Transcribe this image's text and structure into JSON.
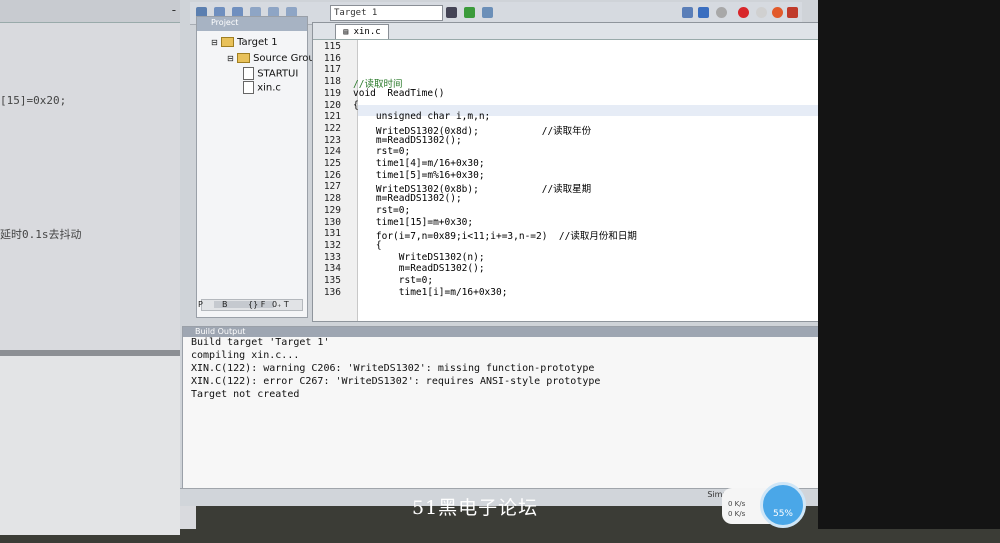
{
  "background_window": {
    "close_controls": "- ×",
    "code_fragment_1": "[15]=0x20;",
    "code_fragment_2": "延时0.1s去抖动"
  },
  "toolbar": {
    "target_select": "Target 1"
  },
  "project_panel": {
    "title": "Project",
    "tree": [
      {
        "label": "Target 1"
      },
      {
        "label": "Source Grou"
      },
      {
        "label": "STARTUI"
      },
      {
        "label": "xin.c"
      }
    ],
    "bottom_tabs": [
      "P",
      "B",
      "{} F",
      "0₊ T"
    ]
  },
  "editor": {
    "tab": "xin.c",
    "lines": [
      {
        "n": "115",
        "code": ""
      },
      {
        "n": "116",
        "code": ""
      },
      {
        "n": "117",
        "code": ""
      },
      {
        "n": "118",
        "code": "//读取时间"
      },
      {
        "n": "119",
        "code": "void  ReadTime()"
      },
      {
        "n": "120",
        "code": "{"
      },
      {
        "n": "121",
        "code": "    unsigned char i,m,n;"
      },
      {
        "n": "122",
        "code": "    WriteDS1302(0x8d);           //读取年份"
      },
      {
        "n": "123",
        "code": "    m=ReadDS1302();"
      },
      {
        "n": "124",
        "code": "    rst=0;"
      },
      {
        "n": "125",
        "code": "    time1[4]=m/16+0x30;"
      },
      {
        "n": "126",
        "code": "    time1[5]=m%16+0x30;"
      },
      {
        "n": "127",
        "code": "    WriteDS1302(0x8b);           //读取星期"
      },
      {
        "n": "128",
        "code": "    m=ReadDS1302();"
      },
      {
        "n": "129",
        "code": "    rst=0;"
      },
      {
        "n": "130",
        "code": "    time1[15]=m+0x30;"
      },
      {
        "n": "131",
        "code": "    for(i=7,n=0x89;i<11;i+=3,n-=2)  //读取月份和日期"
      },
      {
        "n": "132",
        "code": "    {"
      },
      {
        "n": "133",
        "code": "        WriteDS1302(n);"
      },
      {
        "n": "134",
        "code": "        m=ReadDS1302();"
      },
      {
        "n": "135",
        "code": "        rst=0;"
      },
      {
        "n": "136",
        "code": "        time1[i]=m/16+0x30;"
      }
    ]
  },
  "output": {
    "title": "Build Output",
    "lines": [
      "Build target 'Target 1'",
      "compiling xin.c...",
      "XIN.C(122): warning C206: 'WriteDS1302': missing function-prototype",
      "XIN.C(122): error C267: 'WriteDS1302': requires ANSI-style prototype",
      "Target not created"
    ]
  },
  "status": {
    "simulation": "Simulation"
  },
  "watermark": "51黑电子论坛",
  "net_monitor": {
    "up": "0 K/s",
    "down": "0 K/s",
    "percent": "55%"
  },
  "colors": {
    "editor_bg": "#ffffff",
    "comment": "#2a7a2a",
    "output_bg": "#f7f7f7"
  }
}
